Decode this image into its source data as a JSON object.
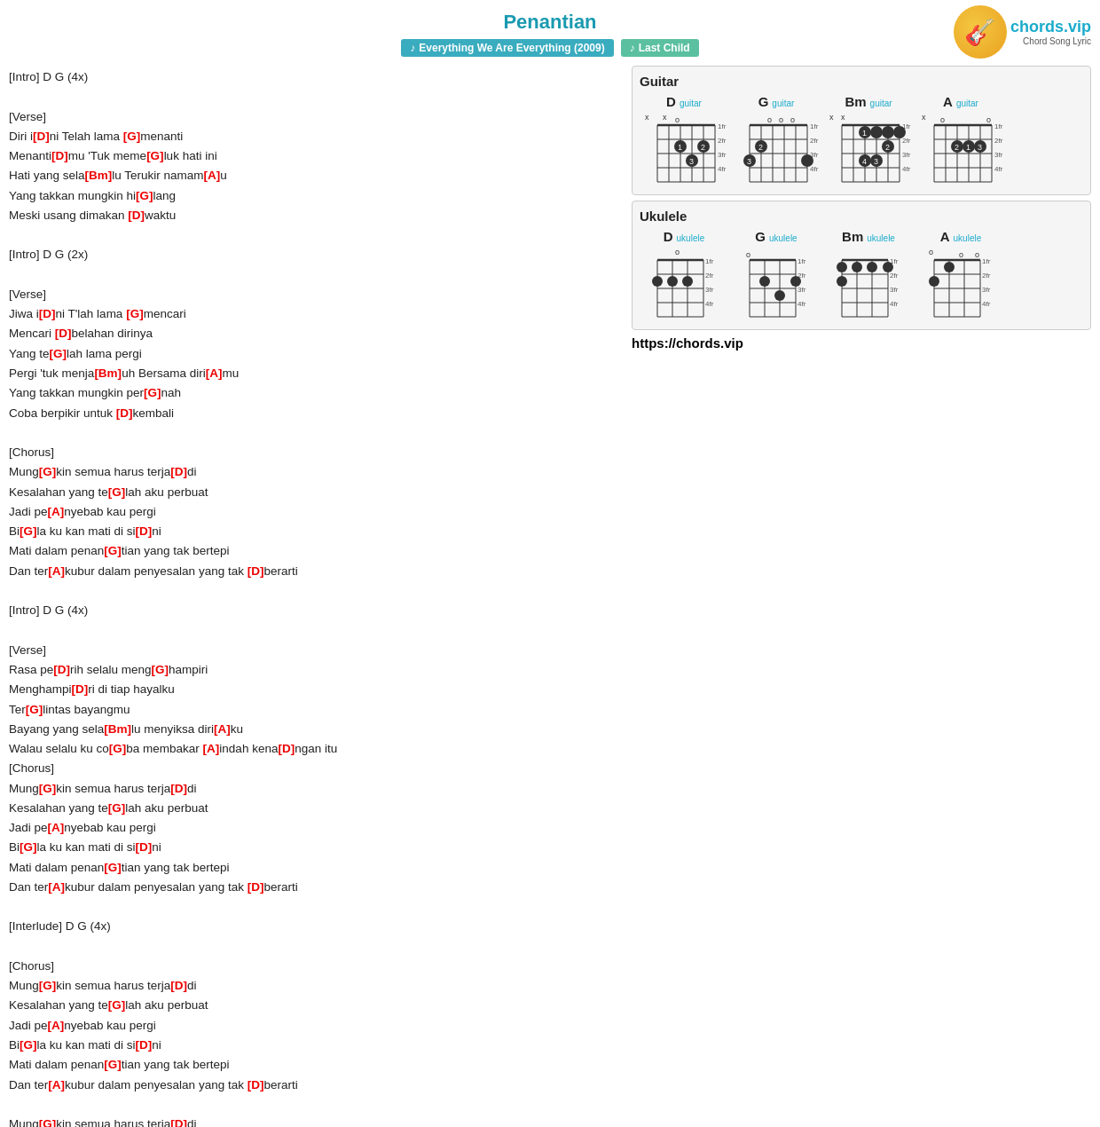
{
  "header": {
    "title": "Penantian",
    "badge_album_icon": "♪",
    "badge_album_text": "Everything We Are Everything (2009)",
    "badge_artist_icon": "♪",
    "badge_artist_text": "Last Child",
    "logo_icon": "🎸",
    "logo_name": "chords.vip",
    "logo_tagline": "Chord Song Lyric"
  },
  "chord_sections": {
    "guitar_title": "Guitar",
    "ukulele_title": "Ukulele",
    "chords": [
      "D",
      "G",
      "Bm",
      "A"
    ],
    "site_url": "https://chords.vip"
  },
  "lyrics": {
    "footer_url": "https://chords.vip"
  }
}
